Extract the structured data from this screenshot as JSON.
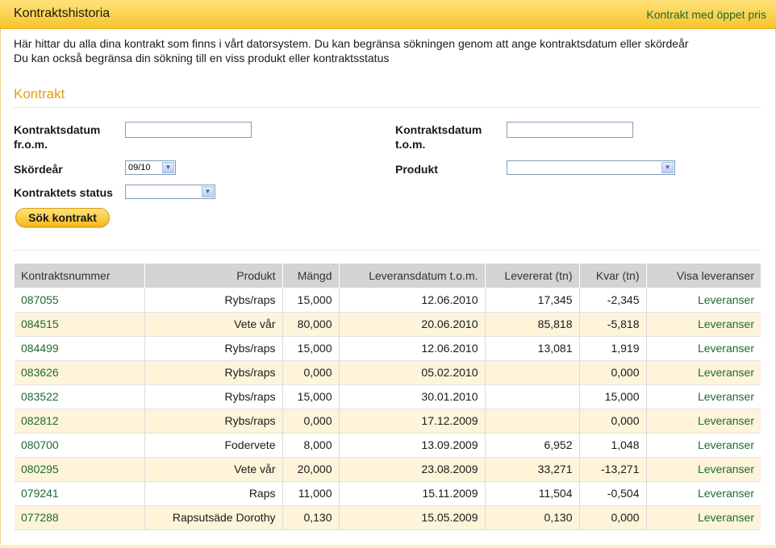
{
  "header": {
    "title": "Kontraktshistoria",
    "link": "Kontrakt med öppet pris"
  },
  "intro": {
    "line1": "Här hittar du alla dina kontrakt som finns i vårt datorsystem. Du kan begränsa sökningen genom att ange kontraktsdatum eller skördeår",
    "line2": "Du kan också begränsa din sökning till en viss produkt eller kontraktsstatus"
  },
  "form": {
    "section_title": "Kontrakt",
    "date_from_label_1": "Kontraktsdatum",
    "date_from_label_2": "fr.o.m.",
    "date_to_label_1": "Kontraktsdatum",
    "date_to_label_2": "t.o.m.",
    "date_from_value": "",
    "date_to_value": "",
    "harvest_label": "Skördeår",
    "harvest_value": "09/10",
    "product_label": "Produkt",
    "product_value": "",
    "status_label": "Kontraktets status",
    "status_value": "",
    "search_button": "Sök kontrakt"
  },
  "table": {
    "columns": [
      "Kontraktsnummer",
      "Produkt",
      "Mängd",
      "Leveransdatum t.o.m.",
      "Levererat (tn)",
      "Kvar (tn)",
      "Visa leveranser"
    ],
    "rows": [
      [
        "087055",
        "Rybs/raps",
        "15,000",
        "12.06.2010",
        "17,345",
        "-2,345",
        "Leveranser"
      ],
      [
        "084515",
        "Vete vår",
        "80,000",
        "20.06.2010",
        "85,818",
        "-5,818",
        "Leveranser"
      ],
      [
        "084499",
        "Rybs/raps",
        "15,000",
        "12.06.2010",
        "13,081",
        "1,919",
        "Leveranser"
      ],
      [
        "083626",
        "Rybs/raps",
        "0,000",
        "05.02.2010",
        "",
        "0,000",
        "Leveranser"
      ],
      [
        "083522",
        "Rybs/raps",
        "15,000",
        "30.01.2010",
        "",
        "15,000",
        "Leveranser"
      ],
      [
        "082812",
        "Rybs/raps",
        "0,000",
        "17.12.2009",
        "",
        "0,000",
        "Leveranser"
      ],
      [
        "080700",
        "Fodervete",
        "8,000",
        "13.09.2009",
        "6,952",
        "1,048",
        "Leveranser"
      ],
      [
        "080295",
        "Vete vår",
        "20,000",
        "23.08.2009",
        "33,271",
        "-13,271",
        "Leveranser"
      ],
      [
        "079241",
        "Raps",
        "11,000",
        "15.11.2009",
        "11,504",
        "-0,504",
        "Leveranser"
      ],
      [
        "077288",
        "Rapsutsäde Dorothy",
        "0,130",
        "15.05.2009",
        "0,130",
        "0,000",
        "Leveranser"
      ]
    ]
  },
  "colors": {
    "header_yellow": "#f7c52c",
    "link_green": "#1f6b34",
    "section_orange": "#e0a012",
    "row_alt": "#fdf4da"
  }
}
